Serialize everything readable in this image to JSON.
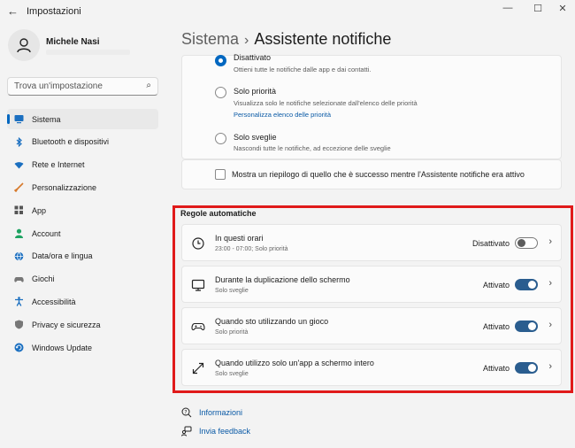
{
  "window": {
    "title": "Impostazioni",
    "back": "←",
    "minimize": "—",
    "maximize": "☐",
    "close": "✕"
  },
  "user": {
    "name": "Michele Nasi"
  },
  "search": {
    "placeholder": "Trova un'impostazione"
  },
  "nav": [
    {
      "label": "Sistema",
      "icon": "monitor-icon",
      "color": "#1b6fc0"
    },
    {
      "label": "Bluetooth e dispositivi",
      "icon": "bluetooth-icon",
      "color": "#1b6fc0"
    },
    {
      "label": "Rete e Internet",
      "icon": "wifi-icon",
      "color": "#1b6fc0"
    },
    {
      "label": "Personalizzazione",
      "icon": "brush-icon",
      "color": "#d77a2c"
    },
    {
      "label": "App",
      "icon": "apps-icon",
      "color": "#555555"
    },
    {
      "label": "Account",
      "icon": "person-icon",
      "color": "#1ea362"
    },
    {
      "label": "Data/ora e lingua",
      "icon": "globe-icon",
      "color": "#1b6fc0"
    },
    {
      "label": "Giochi",
      "icon": "gamepad-icon",
      "color": "#777777"
    },
    {
      "label": "Accessibilità",
      "icon": "accessibility-icon",
      "color": "#1b6fc0"
    },
    {
      "label": "Privacy e sicurezza",
      "icon": "shield-icon",
      "color": "#777777"
    },
    {
      "label": "Windows Update",
      "icon": "update-icon",
      "color": "#1b6fc0"
    }
  ],
  "breadcrumb": {
    "parent": "Sistema",
    "separator": "›",
    "current": "Assistente notifiche"
  },
  "options": [
    {
      "title": "Disattivato",
      "desc": "Ottieni tutte le notifiche dalle app e dai contatti.",
      "selected": true
    },
    {
      "title": "Solo priorità",
      "desc": "Visualizza solo le notifiche selezionate dall'elenco delle priorità",
      "link": "Personalizza elenco delle priorità",
      "selected": false
    },
    {
      "title": "Solo sveglie",
      "desc": "Nascondi tutte le notifiche, ad eccezione delle sveglie",
      "selected": false
    }
  ],
  "summary_checkbox": {
    "label": "Mostra un riepilogo di quello che è successo mentre l'Assistente notifiche era attivo",
    "checked": false
  },
  "rules_section": {
    "title": "Regole automatiche",
    "rules": [
      {
        "title": "In questi orari",
        "desc": "23:00 - 07:00; Solo priorità",
        "status": "Disattivato",
        "on": false,
        "icon": "clock-icon"
      },
      {
        "title": "Durante la duplicazione dello schermo",
        "desc": "Solo sveglie",
        "status": "Attivato",
        "on": true,
        "icon": "display-icon"
      },
      {
        "title": "Quando sto utilizzando un gioco",
        "desc": "Solo priorità",
        "status": "Attivato",
        "on": true,
        "icon": "controller-icon"
      },
      {
        "title": "Quando utilizzo solo un'app a schermo intero",
        "desc": "Solo sveglie",
        "status": "Attivato",
        "on": true,
        "icon": "fullscreen-icon"
      }
    ]
  },
  "footer": {
    "info": "Informazioni",
    "feedback": "Invia feedback"
  },
  "colors": {
    "accent": "#0067c0",
    "highlight": "#e01a1a",
    "toggle_on": "#2a5d8f"
  }
}
